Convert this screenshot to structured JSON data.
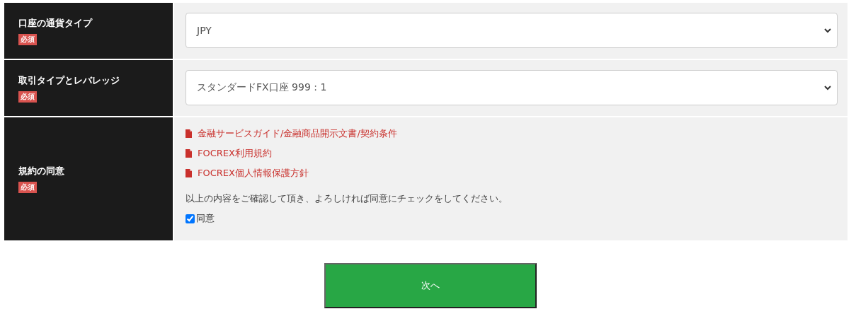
{
  "rows": [
    {
      "kind": "select",
      "label": "口座の通貨タイプ",
      "required_badge": "必須",
      "value": "JPY"
    },
    {
      "kind": "select",
      "label": "取引タイプとレバレッジ",
      "required_badge": "必須",
      "value": "スタンダードFX口座 999 : 1"
    },
    {
      "kind": "agreement",
      "label": "規約の同意",
      "required_badge": "必須",
      "documents": [
        "金融サービスガイド/金融商品開示文書/契約条件",
        "FOCREX利用規約",
        "FOCREX個人情報保護方針"
      ],
      "instruction": "以上の内容をご確認して頂き、よろしければ同意にチェックをしてください。",
      "checkbox": {
        "label": "同意",
        "checked": true
      }
    }
  ],
  "next_button": "次へ"
}
